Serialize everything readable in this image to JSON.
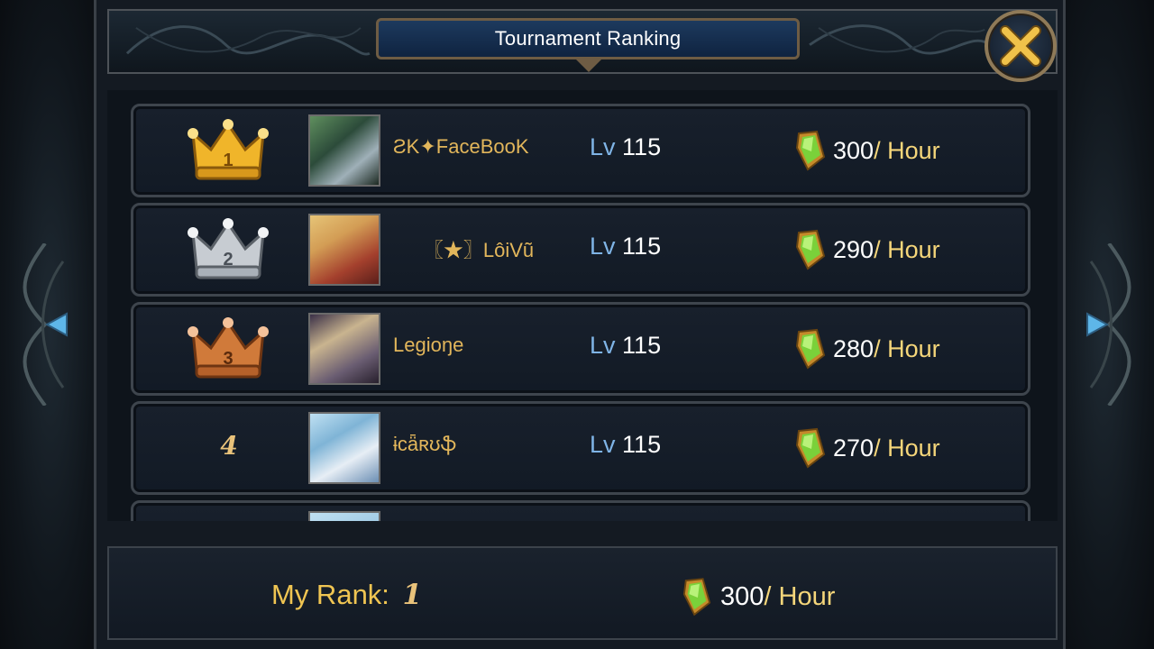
{
  "header": {
    "title": "Tournament Ranking"
  },
  "icons": {
    "close": "close-x-icon",
    "gem": "green-gem-icon",
    "crown": "crown-icon",
    "nav_prev": "arrow-left-icon",
    "nav_next": "arrow-right-icon"
  },
  "colors": {
    "gold_crown": "#f0b52a",
    "silver_crown": "#c7ccd2",
    "bronze_crown": "#d07a3a",
    "name": "#e2b65b",
    "lv_label": "#7fb4e6",
    "unit": "#f5d67a"
  },
  "rankings": [
    {
      "rank": "1",
      "name": "ƧK✦FaceBooK",
      "lv_label": "Lv",
      "level": "115",
      "reward_value": "300",
      "reward_unit": "/ Hour"
    },
    {
      "rank": "2",
      "name": "〖★〗LôiVũ",
      "lv_label": "Lv",
      "level": "115",
      "reward_value": "290",
      "reward_unit": "/ Hour"
    },
    {
      "rank": "3",
      "name": "Legioŋe",
      "lv_label": "Lv",
      "level": "115",
      "reward_value": "280",
      "reward_unit": "/ Hour"
    },
    {
      "rank": "4",
      "name": "ɨcǟʀʊֆ",
      "lv_label": "Lv",
      "level": "115",
      "reward_value": "270",
      "reward_unit": "/ Hour"
    }
  ],
  "footer": {
    "my_rank_label": "My Rank:",
    "my_rank_value": "1",
    "reward_value": "300",
    "reward_unit": "/ Hour"
  }
}
